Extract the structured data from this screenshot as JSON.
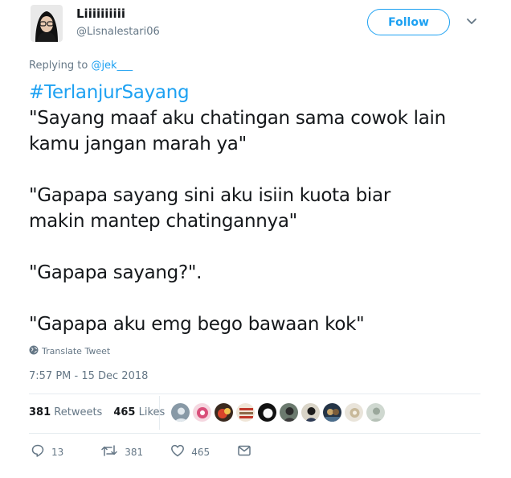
{
  "user": {
    "display_name": "Liiiiiiiiii",
    "handle": "@Lisnalestari06"
  },
  "follow_label": "Follow",
  "reply": {
    "prefix": "Replying to ",
    "mention": "@jek___"
  },
  "tweet": {
    "hashtag": "#TerlanjurSayang",
    "line1": "\"Sayang maaf aku chatingan sama cowok lain",
    "line2": "kamu jangan marah ya\"",
    "line3": "\"Gapapa sayang sini aku isiin kuota biar",
    "line4": "makin mantep chatingannya\"",
    "line5": "\"Gapapa sayang?\".",
    "line6": "\"Gapapa aku emg bego bawaan kok\""
  },
  "translate_label": "Translate Tweet",
  "timestamp": "7:57 PM - 15 Dec 2018",
  "stats": {
    "retweets_count": "381",
    "retweets_label": "Retweets",
    "likes_count": "465",
    "likes_label": "Likes"
  },
  "actions": {
    "reply_count": "13",
    "retweet_count": "381",
    "like_count": "465"
  },
  "colors": {
    "accent": "#1da1f2",
    "muted": "#657786",
    "text": "#14171a"
  }
}
